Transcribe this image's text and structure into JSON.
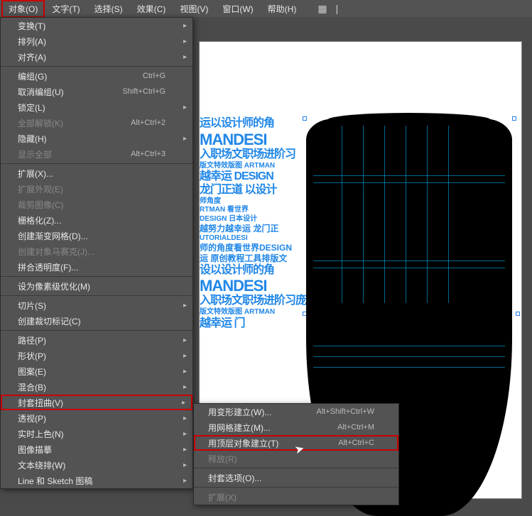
{
  "menubar": {
    "items": [
      "对象(O)",
      "文字(T)",
      "选择(S)",
      "效果(C)",
      "视图(V)",
      "窗口(W)",
      "帮助(H)"
    ]
  },
  "dropdown": {
    "groups": [
      [
        {
          "label": "变换(T)",
          "sub": true
        },
        {
          "label": "排列(A)",
          "sub": true
        },
        {
          "label": "对齐(A)",
          "sub": true
        }
      ],
      [
        {
          "label": "编组(G)",
          "shortcut": "Ctrl+G"
        },
        {
          "label": "取消编组(U)",
          "shortcut": "Shift+Ctrl+G"
        },
        {
          "label": "锁定(L)",
          "sub": true
        },
        {
          "label": "全部解锁(K)",
          "shortcut": "Alt+Ctrl+2",
          "disabled": true
        },
        {
          "label": "隐藏(H)",
          "sub": true
        },
        {
          "label": "显示全部",
          "shortcut": "Alt+Ctrl+3",
          "disabled": true
        }
      ],
      [
        {
          "label": "扩展(X)..."
        },
        {
          "label": "扩展外观(E)",
          "disabled": true
        },
        {
          "label": "裁剪图像(C)",
          "disabled": true
        },
        {
          "label": "栅格化(Z)..."
        },
        {
          "label": "创建渐变网格(D)..."
        },
        {
          "label": "创建对象马赛克(J)...",
          "disabled": true
        },
        {
          "label": "拼合透明度(F)..."
        }
      ],
      [
        {
          "label": "设为像素级优化(M)"
        }
      ],
      [
        {
          "label": "切片(S)",
          "sub": true
        },
        {
          "label": "创建裁切标记(C)"
        }
      ],
      [
        {
          "label": "路径(P)",
          "sub": true
        },
        {
          "label": "形状(P)",
          "sub": true
        },
        {
          "label": "图案(E)",
          "sub": true
        },
        {
          "label": "混合(B)",
          "sub": true
        },
        {
          "label": "封套扭曲(V)",
          "sub": true,
          "highlight": true
        },
        {
          "label": "透视(P)",
          "sub": true
        },
        {
          "label": "实时上色(N)",
          "sub": true
        },
        {
          "label": "图像描摹",
          "sub": true
        },
        {
          "label": "文本绕排(W)",
          "sub": true
        },
        {
          "label": "Line 和 Sketch 图稿",
          "sub": true
        }
      ]
    ]
  },
  "submenu": {
    "groups": [
      [
        {
          "label": "用变形建立(W)...",
          "shortcut": "Alt+Shift+Ctrl+W"
        },
        {
          "label": "用网格建立(M)...",
          "shortcut": "Alt+Ctrl+M"
        },
        {
          "label": "用顶层对象建立(T)",
          "shortcut": "Alt+Ctrl+C",
          "highlight": true
        },
        {
          "label": "释放(R)",
          "disabled": true
        }
      ],
      [
        {
          "label": "封套选项(O)..."
        }
      ],
      [
        {
          "label": "扩展(X)",
          "disabled": true
        }
      ]
    ]
  },
  "textcloud": {
    "l1": "运以设计师的角",
    "l2": "MANDESI",
    "l3": "入职场文职场进阶习",
    "l4": "版文特效版图 ARTMAN",
    "l5": "越幸运 DESIGN",
    "l6": "龙门正道 以设计",
    "l7": "师角度",
    "l8": "RTMAN 看世界",
    "l9": "DESIGN 日本设计",
    "l10": "越努力越幸运 龙门正",
    "l11": "UTORIALDESI",
    "l12": "师的角度看世界DESIGN",
    "l13": "运 原创教程工具排版文",
    "l14": "设以设计师的角",
    "l15": "MANDESI",
    "l16": "入职场文职场进阶习庞",
    "l17": "版文特效版图 ARTMAN",
    "l18": "越幸运 门"
  }
}
